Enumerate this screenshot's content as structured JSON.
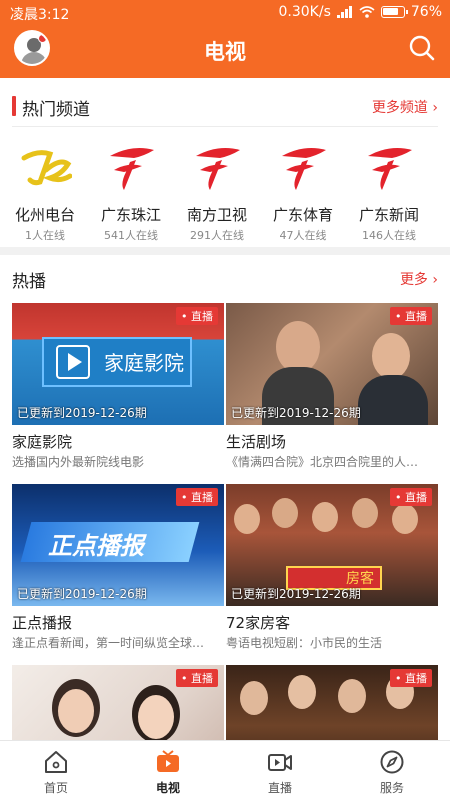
{
  "status_bar": {
    "time": "凌晨3:12",
    "speed": "0.30K/s",
    "battery": "76%"
  },
  "header": {
    "title": "电视"
  },
  "hot_channels": {
    "title": "热门频道",
    "more": "更多频道",
    "items": [
      {
        "name": "化州电台",
        "count": "1人在线"
      },
      {
        "name": "广东珠江",
        "count": "541人在线"
      },
      {
        "name": "南方卫视",
        "count": "291人在线"
      },
      {
        "name": "广东体育",
        "count": "47人在线"
      },
      {
        "name": "广东新闻",
        "count": "146人在线"
      }
    ]
  },
  "hot_play": {
    "title": "热播",
    "more": "更多",
    "cards": [
      {
        "badge": "直播",
        "update": "已更新到2019-12-26期",
        "title": "家庭影院",
        "desc": "选播国内外最新院线电影",
        "thumb_text": "家庭影院"
      },
      {
        "badge": "直播",
        "update": "已更新到2019-12-26期",
        "title": "生活剧场",
        "desc": "《情满四合院》北京四合院里的人…"
      },
      {
        "badge": "直播",
        "update": "已更新到2019-12-26期",
        "title": "正点播报",
        "desc": "逢正点看新闻，第一时间纵览全球…",
        "thumb_text": "正点播报"
      },
      {
        "badge": "直播",
        "update": "已更新到2019-12-26期",
        "title": "72家房客",
        "desc": "粤语电视短剧：小市民的生活",
        "thumb_text": "房客"
      },
      {
        "badge": "直播"
      },
      {
        "badge": "直播"
      }
    ]
  },
  "bottom_nav": {
    "items": [
      {
        "label": "首页"
      },
      {
        "label": "电视"
      },
      {
        "label": "直播"
      },
      {
        "label": "服务"
      }
    ]
  },
  "colors": {
    "brand": "#f56a25",
    "accent_red": "#e53935"
  }
}
